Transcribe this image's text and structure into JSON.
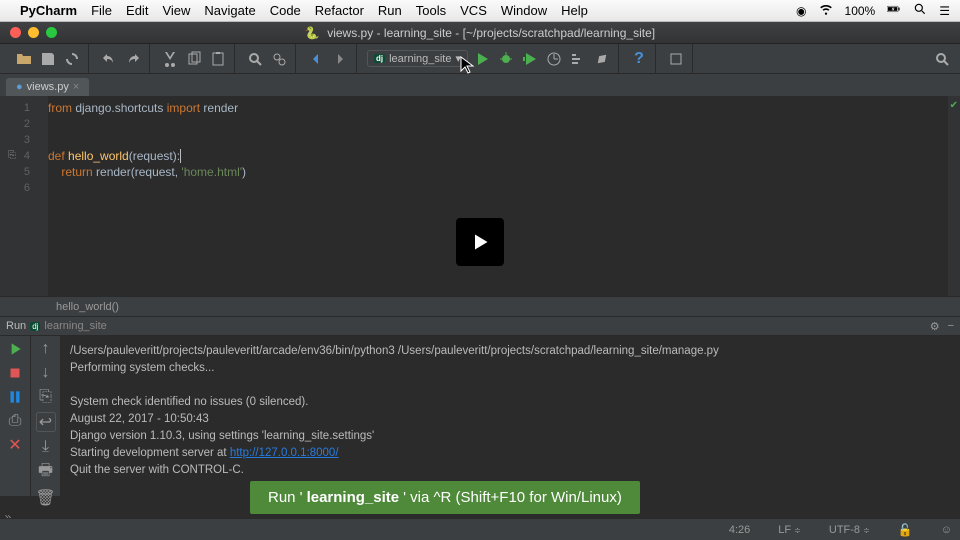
{
  "mac_menu": {
    "app": "PyCharm",
    "items": [
      "File",
      "Edit",
      "View",
      "Navigate",
      "Code",
      "Refactor",
      "Run",
      "Tools",
      "VCS",
      "Window",
      "Help"
    ],
    "battery": "100%"
  },
  "window_title": {
    "filename": "views.py",
    "project": "learning_site",
    "path": "[~/projects/scratchpad/learning_site]"
  },
  "run_config_selector": "learning_site",
  "editor_tab": {
    "filename": "views.py"
  },
  "code": {
    "lines": {
      "l1_from": "from",
      "l1_mod": " django.shortcuts ",
      "l1_import": "import",
      "l1_name": " render",
      "l4_def": "def ",
      "l4_fn": "hello_world",
      "l4_sig": "(request):",
      "l5_indent": "    ",
      "l5_return": "return ",
      "l5_call": "render",
      "l5_open": "(",
      "l5_arg1": "request",
      "l5_comma": ", ",
      "l5_str": "'home.html'",
      "l5_close": ")"
    },
    "line_nums": [
      "1",
      "2",
      "3",
      "4",
      "5",
      "6"
    ]
  },
  "breadcrumb": "hello_world()",
  "run_tool": {
    "label": "Run",
    "config": "learning_site"
  },
  "console": {
    "line1": "/Users/pauleveritt/projects/pauleveritt/arcade/env36/bin/python3 /Users/pauleveritt/projects/scratchpad/learning_site/manage.py",
    "line2": "Performing system checks...",
    "line3": "",
    "line4": "System check identified no issues (0 silenced).",
    "line5": "August 22, 2017 - 10:50:43",
    "line6": "Django version 1.10.3, using settings 'learning_site.settings'",
    "line7_a": "Starting development server at ",
    "line7_url": "http://127.0.0.1:8000/",
    "line8": "Quit the server with CONTROL-C."
  },
  "status": {
    "caret": "4:26",
    "line_sep": "LF",
    "encoding": "UTF-8"
  },
  "tip": {
    "pre": "Run '",
    "target": "learning_site",
    "post": "' via ^R (Shift+F10 for Win/Linux)"
  }
}
